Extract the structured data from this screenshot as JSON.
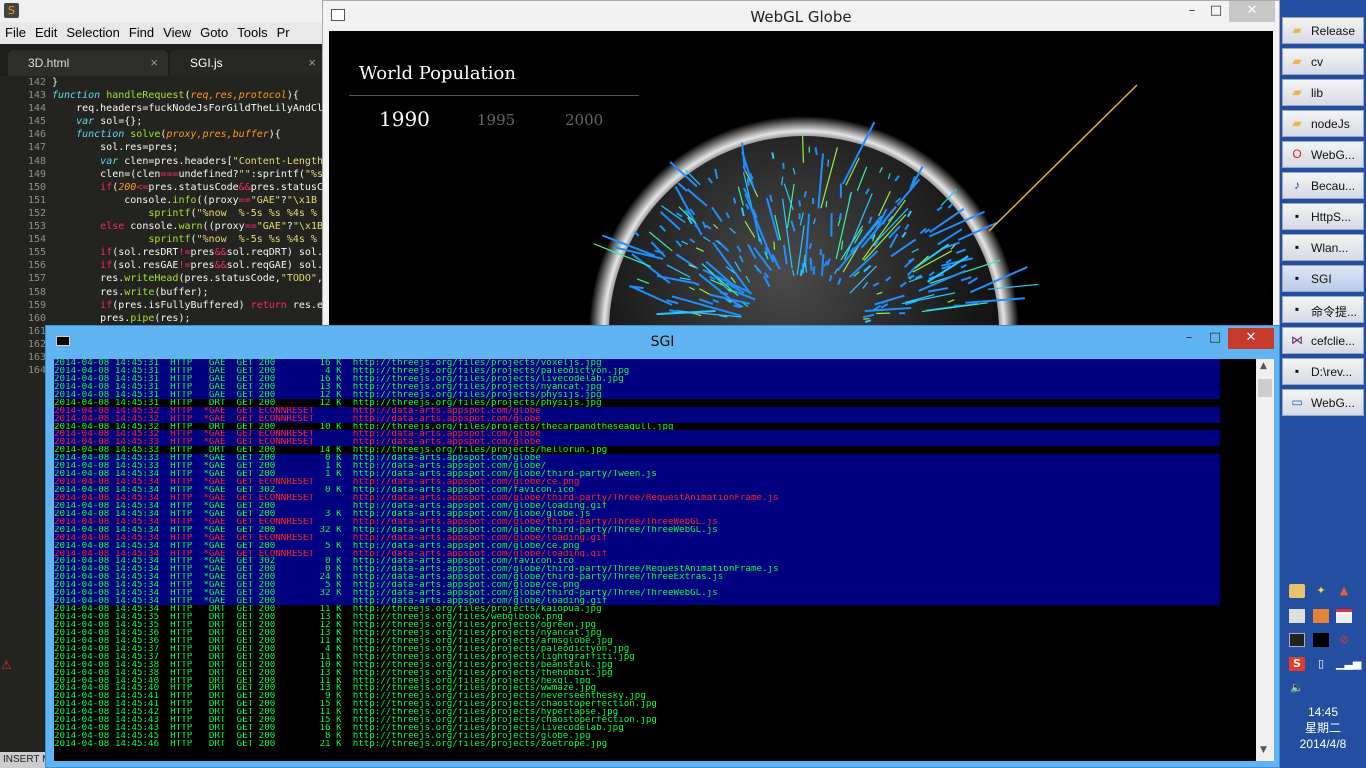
{
  "editor": {
    "menu": [
      "File",
      "Edit",
      "Selection",
      "Find",
      "View",
      "Goto",
      "Tools",
      "Pr"
    ],
    "tabs": [
      "3D.html",
      "SGI.js"
    ],
    "active_tab": 1,
    "status_text": "INSERT MO",
    "first_line": 142,
    "code_lines": [
      [
        [
          "}",
          ""
        ]
      ],
      [
        [
          "function ",
          "kw"
        ],
        [
          "handleRequest",
          "fn"
        ],
        [
          "(",
          ""
        ],
        [
          "req,res,protocol",
          "pr"
        ],
        [
          "){",
          ""
        ]
      ],
      [
        [
          "    req.headers",
          ""
        ],
        [
          "=",
          ""
        ],
        [
          "fuckNodeJsForGildTheLilyAndCl",
          ""
        ]
      ],
      [
        [
          "    ",
          ""
        ],
        [
          "var ",
          "kw"
        ],
        [
          "sol",
          ""
        ],
        [
          "=",
          ""
        ],
        [
          "{};",
          ""
        ]
      ],
      [
        [
          "    ",
          ""
        ],
        [
          "function ",
          "kw"
        ],
        [
          "solve",
          "fn"
        ],
        [
          "(",
          ""
        ],
        [
          "proxy,pres,buffer",
          "pr"
        ],
        [
          "){",
          ""
        ]
      ],
      [
        [
          "        sol.res",
          ""
        ],
        [
          "=",
          ""
        ],
        [
          "pres;",
          ""
        ]
      ],
      [
        [
          "        ",
          ""
        ],
        [
          "var ",
          "kw"
        ],
        [
          "clen",
          ""
        ],
        [
          "=",
          ""
        ],
        [
          "pres.headers[",
          ""
        ],
        [
          "\"Content-Length",
          "st"
        ]
      ],
      [
        [
          "        clen",
          ""
        ],
        [
          "=",
          ""
        ],
        [
          "(clen",
          ""
        ],
        [
          "===",
          "op"
        ],
        [
          "undefined?",
          ""
        ],
        [
          "\"\"",
          "st"
        ],
        [
          ":sprintf(",
          ""
        ],
        [
          "\"%s",
          "st"
        ]
      ],
      [
        [
          "        ",
          ""
        ],
        [
          "if",
          "op"
        ],
        [
          "(",
          ""
        ],
        [
          "200",
          "pr"
        ],
        [
          "<=",
          "op"
        ],
        [
          "pres.statusCode",
          ""
        ],
        [
          "&&",
          "op"
        ],
        [
          "pres.statusC",
          ""
        ]
      ],
      [
        [
          "            console.",
          ""
        ],
        [
          "info",
          "fn"
        ],
        [
          "((proxy",
          ""
        ],
        [
          "==",
          "op"
        ],
        [
          "\"GAE\"",
          "st"
        ],
        [
          "?",
          ""
        ],
        [
          "\"\\x1B",
          "st"
        ]
      ],
      [
        [
          "                ",
          ""
        ],
        [
          "sprintf",
          "fn"
        ],
        [
          "(",
          ""
        ],
        [
          "\"%now  %-5s %s %4s %",
          "st"
        ]
      ],
      [
        [
          "        ",
          ""
        ],
        [
          "else ",
          "op"
        ],
        [
          "console.",
          ""
        ],
        [
          "warn",
          "fn"
        ],
        [
          "((proxy",
          ""
        ],
        [
          "==",
          "op"
        ],
        [
          "\"GAE\"",
          "st"
        ],
        [
          "?",
          ""
        ],
        [
          "\"\\x1B",
          "st"
        ]
      ],
      [
        [
          "                ",
          ""
        ],
        [
          "sprintf",
          "fn"
        ],
        [
          "(",
          ""
        ],
        [
          "\"%now  %-5s %s %4s %",
          "st"
        ]
      ],
      [
        [
          "        ",
          ""
        ],
        [
          "if",
          "op"
        ],
        [
          "(sol.resDRT",
          ""
        ],
        [
          "!=",
          "op"
        ],
        [
          "pres",
          ""
        ],
        [
          "&&",
          "op"
        ],
        [
          "sol.reqDRT) sol.",
          ""
        ]
      ],
      [
        [
          "        ",
          ""
        ],
        [
          "if",
          "op"
        ],
        [
          "(sol.resGAE",
          ""
        ],
        [
          "!=",
          "op"
        ],
        [
          "pres",
          ""
        ],
        [
          "&&",
          "op"
        ],
        [
          "sol.reqGAE) sol.",
          ""
        ]
      ],
      [
        [
          "        res.",
          ""
        ],
        [
          "writeHead",
          "fn"
        ],
        [
          "(pres.statusCode,",
          ""
        ],
        [
          "\"TODO\"",
          "st"
        ],
        [
          ",",
          ""
        ]
      ],
      [
        [
          "        res.",
          ""
        ],
        [
          "write",
          "fn"
        ],
        [
          "(buffer);",
          ""
        ]
      ],
      [
        [
          "        ",
          ""
        ],
        [
          "if",
          "op"
        ],
        [
          "(pres.isFullyBuffered) ",
          ""
        ],
        [
          "return ",
          "op"
        ],
        [
          "res.e",
          ""
        ]
      ],
      [
        [
          "        pres.",
          ""
        ],
        [
          "pipe",
          "fn"
        ],
        [
          "(res);",
          ""
        ]
      ],
      [
        [
          "    }",
          ""
        ]
      ],
      [
        [
          "",
          ""
        ]
      ],
      [
        [
          "",
          ""
        ]
      ],
      [
        [
          "",
          ""
        ]
      ]
    ]
  },
  "globe_window": {
    "title": "WebGL Globe",
    "heading": "World Population",
    "years": [
      "1990",
      "1995",
      "2000"
    ],
    "active_year": "1990"
  },
  "console": {
    "title": "SGI",
    "rows": [
      [
        "2014-04-08 14:45:31  HTTP   GAE  GET 200        16 K  http://threejs.org/files/projects/voxeljs.jpg",
        "g",
        "b"
      ],
      [
        "2014-04-08 14:45:31  HTTP   GAE  GET 200         4 K  http://threejs.org/files/projects/paleodictyon.jpg",
        "g",
        "b"
      ],
      [
        "2014-04-08 14:45:31  HTTP   GAE  GET 200        16 K  http://threejs.org/files/projects/livecodelab.jpg",
        "g",
        "b"
      ],
      [
        "2014-04-08 14:45:31  HTTP   GAE  GET 200        13 K  http://threejs.org/files/projects/nyancat.jpg",
        "g",
        "b"
      ],
      [
        "2014-04-08 14:45:31  HTTP   GAE  GET 200        12 K  http://threejs.org/files/projects/physijs.jpg",
        "g",
        "b"
      ],
      [
        "2014-04-08 14:45:31  HTTP   DRT  GET 200        12 K  http://threejs.org/files/projects/physijs.jpg",
        "g",
        ""
      ],
      [
        "2014-04-08 14:45:32  HTTP  *GAE  GET ECONNRESET       http://data-arts.appspot.com/globe",
        "r",
        "b"
      ],
      [
        "2014-04-08 14:45:32  HTTP  *GAE  GET ECONNRESET       http://data-arts.appspot.com/globe",
        "r",
        "b"
      ],
      [
        "2014-04-08 14:45:32  HTTP   DRT  GET 200        10 K  http://threejs.org/files/projects/thecarpandtheseagull.jpg",
        "g",
        ""
      ],
      [
        "2014-04-08 14:45:32  HTTP  *GAE  GET ECONNRESET       http://data-arts.appspot.com/globe",
        "r",
        "b"
      ],
      [
        "2014-04-08 14:45:33  HTTP  *GAE  GET ECONNRESET       http://data-arts.appspot.com/globe",
        "r",
        "b"
      ],
      [
        "2014-04-08 14:45:33  HTTP   DRT  GET 200        14 K  http://threejs.org/files/projects/hellorun.jpg",
        "g",
        ""
      ],
      [
        "2014-04-08 14:45:33  HTTP  *GAE  GET 200         0 K  http://data-arts.appspot.com/globe",
        "g",
        "b"
      ],
      [
        "2014-04-08 14:45:33  HTTP  *GAE  GET 200         1 K  http://data-arts.appspot.com/globe/",
        "g",
        "b"
      ],
      [
        "2014-04-08 14:45:34  HTTP  *GAE  GET 200         1 K  http://data-arts.appspot.com/globe/third-party/Tween.js",
        "g",
        "b"
      ],
      [
        "2014-04-08 14:45:34  HTTP  *GAE  GET ECONNRESET       http://data-arts.appspot.com/globe/ce.png",
        "r",
        "b"
      ],
      [
        "2014-04-08 14:45:34  HTTP  *GAE  GET 302         0 K  http://data-arts.appspot.com/favicon.ico",
        "g",
        "b"
      ],
      [
        "2014-04-08 14:45:34  HTTP  *GAE  GET ECONNRESET       http://data-arts.appspot.com/globe/third-party/Three/RequestAnimationFrame.js",
        "r",
        "b"
      ],
      [
        "2014-04-08 14:45:34  HTTP  *GAE  GET 200              http://data-arts.appspot.com/globe/loading.gif",
        "g",
        "b"
      ],
      [
        "2014-04-08 14:45:34  HTTP  *GAE  GET 200         3 K  http://data-arts.appspot.com/globe/globe.js",
        "g",
        "b"
      ],
      [
        "2014-04-08 14:45:34  HTTP  *GAE  GET ECONNRESET       http://data-arts.appspot.com/globe/third-party/Three/ThreeWebGL.js",
        "r",
        "b"
      ],
      [
        "2014-04-08 14:45:34  HTTP  *GAE  GET 200        32 K  http://data-arts.appspot.com/globe/third-party/Three/ThreeWebGL.js",
        "g",
        "b"
      ],
      [
        "2014-04-08 14:45:34  HTTP  *GAE  GET ECONNRESET       http://data-arts.appspot.com/globe/loading.gif",
        "r",
        "b"
      ],
      [
        "2014-04-08 14:45:34  HTTP  *GAE  GET 200         5 K  http://data-arts.appspot.com/globe/ce.png",
        "g",
        "b"
      ],
      [
        "2014-04-08 14:45:34  HTTP  *GAE  GET ECONNRESET       http://data-arts.appspot.com/globe/loading.gif",
        "r",
        "b"
      ],
      [
        "2014-04-08 14:45:34  HTTP  *GAE  GET 302         0 K  http://data-arts.appspot.com/favicon.ico",
        "g",
        "b"
      ],
      [
        "2014-04-08 14:45:34  HTTP  *GAE  GET 200         0 K  http://data-arts.appspot.com/globe/third-party/Three/RequestAnimationFrame.js",
        "g",
        "b"
      ],
      [
        "2014-04-08 14:45:34  HTTP  *GAE  GET 200        24 K  http://data-arts.appspot.com/globe/third-party/Three/ThreeExtras.js",
        "g",
        "b"
      ],
      [
        "2014-04-08 14:45:34  HTTP  *GAE  GET 200         5 K  http://data-arts.appspot.com/globe/ce.png",
        "g",
        "b"
      ],
      [
        "2014-04-08 14:45:34  HTTP  *GAE  GET 200        32 K  http://data-arts.appspot.com/globe/third-party/Three/ThreeWebGL.js",
        "g",
        "b"
      ],
      [
        "2014-04-08 14:45:34  HTTP  *GAE  GET 200              http://data-arts.appspot.com/globe/loading.gif",
        "g",
        "b"
      ],
      [
        "2014-04-08 14:45:34  HTTP   DRT  GET 200        11 K  http://threejs.org/files/projects/kaiopua.jpg",
        "g",
        ""
      ],
      [
        "2014-04-08 14:45:35  HTTP   DRT  GET 200        13 K  http://threejs.org/files/webglbook.png",
        "g",
        ""
      ],
      [
        "2014-04-08 14:45:35  HTTP   DRT  GET 200        12 K  http://threejs.org/files/projects/ogreen.jpg",
        "g",
        ""
      ],
      [
        "2014-04-08 14:45:36  HTTP   DRT  GET 200        13 K  http://threejs.org/files/projects/nyancat.jpg",
        "g",
        ""
      ],
      [
        "2014-04-08 14:45:36  HTTP   DRT  GET 200        11 K  http://threejs.org/files/projects/armsglobe.jpg",
        "g",
        ""
      ],
      [
        "2014-04-08 14:45:37  HTTP   DRT  GET 200         4 K  http://threejs.org/files/projects/paleodictyon.jpg",
        "g",
        ""
      ],
      [
        "2014-04-08 14:45:37  HTTP   DRT  GET 200        11 K  http://threejs.org/files/projects/lightgraffiti.jpg",
        "g",
        ""
      ],
      [
        "2014-04-08 14:45:38  HTTP   DRT  GET 200        10 K  http://threejs.org/files/projects/beanstalk.jpg",
        "g",
        ""
      ],
      [
        "2014-04-08 14:45:38  HTTP   DRT  GET 200        13 K  http://threejs.org/files/projects/thehobbit.jpg",
        "g",
        ""
      ],
      [
        "2014-04-08 14:45:40  HTTP   DRT  GET 200        11 K  http://threejs.org/files/projects/hexgl.jpg",
        "g",
        ""
      ],
      [
        "2014-04-08 14:45:40  HTTP   DRT  GET 200        13 K  http://threejs.org/files/projects/wwmaze.jpg",
        "g",
        ""
      ],
      [
        "2014-04-08 14:45:41  HTTP   DRT  GET 200         9 K  http://threejs.org/files/projects/neverseenthesky.jpg",
        "g",
        ""
      ],
      [
        "2014-04-08 14:45:41  HTTP   DRT  GET 200        15 K  http://threejs.org/files/projects/chaostoperfection.jpg",
        "g",
        ""
      ],
      [
        "2014-04-08 14:45:42  HTTP   DRT  GET 200        11 K  http://threejs.org/files/projects/hyperlapse.jpg",
        "g",
        ""
      ],
      [
        "2014-04-08 14:45:43  HTTP   DRT  GET 200        15 K  http://threejs.org/files/projects/chaostoperfection.jpg",
        "g",
        ""
      ],
      [
        "2014-04-08 14:45:43  HTTP   DRT  GET 200        16 K  http://threejs.org/files/projects/livecodelab.jpg",
        "g",
        ""
      ],
      [
        "2014-04-08 14:45:45  HTTP   DRT  GET 200         8 K  http://threejs.org/files/projects/globe.jpg",
        "g",
        ""
      ],
      [
        "2014-04-08 14:45:46  HTTP   DRT  GET 200        21 K  http://threejs.org/files/projects/zoetrope.jpg",
        "g",
        ""
      ]
    ]
  },
  "taskbar": {
    "items": [
      {
        "label": "Release",
        "icon": "folder-icon"
      },
      {
        "label": "cv",
        "icon": "folder-icon"
      },
      {
        "label": "lib",
        "icon": "folder-icon"
      },
      {
        "label": "nodeJs",
        "icon": "folder-icon"
      },
      {
        "label": "WebG...",
        "icon": "opera-icon"
      },
      {
        "label": "Becau...",
        "icon": "music-icon"
      },
      {
        "label": "HttpS...",
        "icon": "console-icon"
      },
      {
        "label": "Wlan...",
        "icon": "console-icon"
      },
      {
        "label": "SGI",
        "icon": "console-icon"
      },
      {
        "label": "命令提...",
        "icon": "console-icon"
      },
      {
        "label": "cefclie...",
        "icon": "visual-studio-icon"
      },
      {
        "label": "D:\\rev...",
        "icon": "console-icon"
      },
      {
        "label": "WebG...",
        "icon": "window-icon"
      }
    ],
    "active_index": 8,
    "clock_time": "14:45",
    "clock_day": "星期二",
    "clock_date": "2014/4/8"
  }
}
